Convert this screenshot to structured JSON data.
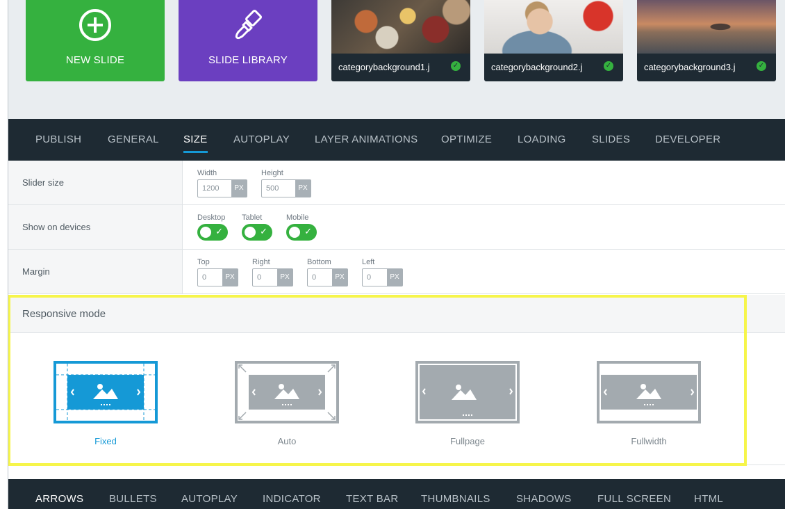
{
  "slides": {
    "new_slide_label": "NEW SLIDE",
    "slide_library_label": "SLIDE LIBRARY",
    "images": [
      {
        "name": "categorybackground1.j"
      },
      {
        "name": "categorybackground2.j"
      },
      {
        "name": "categorybackground3.j"
      }
    ]
  },
  "main_tabs": [
    "PUBLISH",
    "GENERAL",
    "SIZE",
    "AUTOPLAY",
    "LAYER ANIMATIONS",
    "OPTIMIZE",
    "LOADING",
    "SLIDES",
    "DEVELOPER"
  ],
  "active_main_tab": "SIZE",
  "size_settings": {
    "slider_size": {
      "label": "Slider size",
      "width_label": "Width",
      "width_value": "1200",
      "height_label": "Height",
      "height_value": "500",
      "unit": "PX"
    },
    "show_on_devices": {
      "label": "Show on devices",
      "desktop_label": "Desktop",
      "desktop_on": true,
      "tablet_label": "Tablet",
      "tablet_on": true,
      "mobile_label": "Mobile",
      "mobile_on": true
    },
    "margin": {
      "label": "Margin",
      "top_label": "Top",
      "top_value": "0",
      "right_label": "Right",
      "right_value": "0",
      "bottom_label": "Bottom",
      "bottom_value": "0",
      "left_label": "Left",
      "left_value": "0",
      "unit": "PX"
    }
  },
  "responsive_mode": {
    "title": "Responsive mode",
    "modes": [
      "Fixed",
      "Auto",
      "Fullpage",
      "Fullwidth"
    ],
    "selected": "Fixed"
  },
  "bottom_tabs": [
    "ARROWS",
    "BULLETS",
    "AUTOPLAY",
    "INDICATOR",
    "TEXT BAR",
    "THUMBNAILS",
    "SHADOWS",
    "FULL SCREEN",
    "HTML"
  ],
  "active_bottom_tab": "ARROWS",
  "colors": {
    "new_slide": "#35b13f",
    "slide_library": "#6b3fc0",
    "dark_bar": "#1e2a33",
    "accent_blue": "#1599d6",
    "toggle_on": "#35b13f",
    "highlight": "#f6f54a"
  }
}
